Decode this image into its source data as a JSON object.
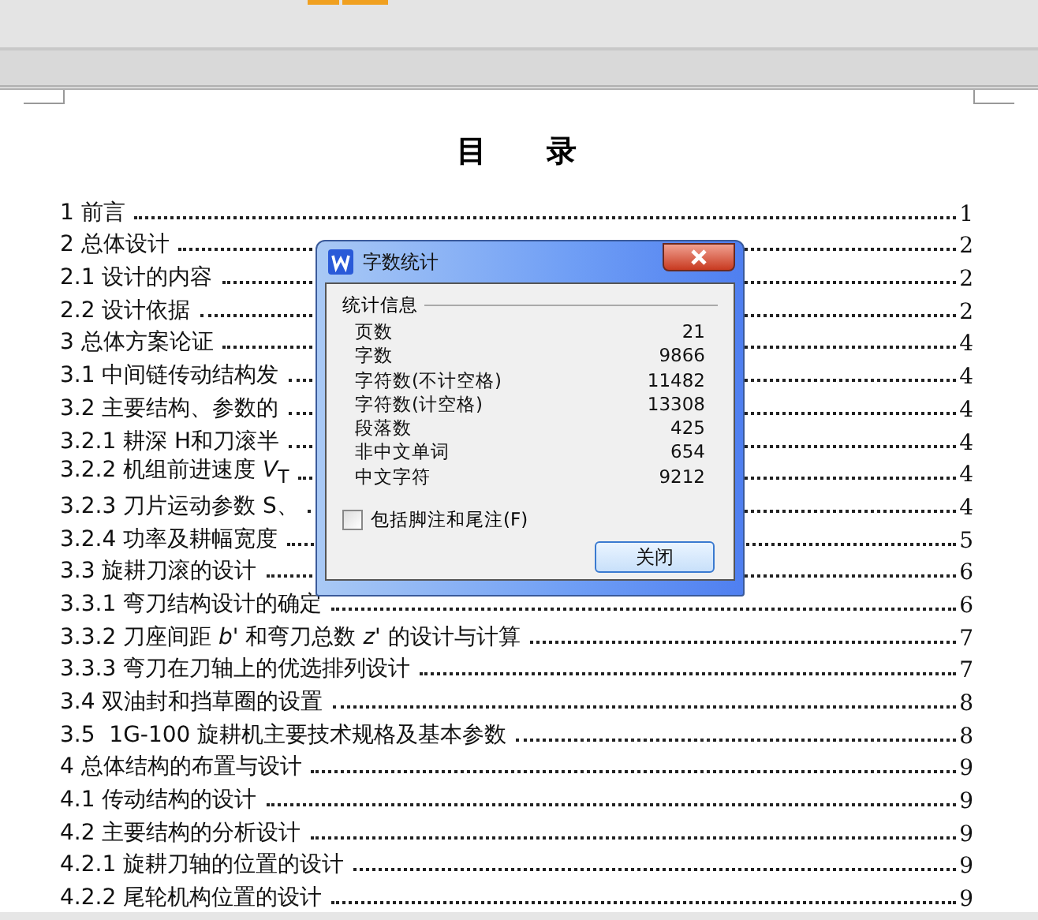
{
  "document": {
    "title": "目　　录",
    "toc": [
      {
        "text": "1 前言",
        "page": "1"
      },
      {
        "text": "2 总体设计",
        "page": "2"
      },
      {
        "text": "2.1 设计的内容",
        "page": "2"
      },
      {
        "text": "2.2 设计依据",
        "page": "2"
      },
      {
        "text": "3 总体方案论证",
        "page": "4"
      },
      {
        "text": "3.1 中间链传动结构发",
        "page": "4"
      },
      {
        "text": "3.2 主要结构、参数的",
        "page": "4"
      },
      {
        "text": "3.2.1 耕深 H和刀滚半",
        "page": "4"
      },
      {
        "text": "3.2.2 机组前进速度 *V*$_{T}$",
        "page": "4"
      },
      {
        "text": "3.2.3 刀片运动参数 S、",
        "page": "4"
      },
      {
        "text": "3.2.4 功率及耕幅宽度",
        "page": "5"
      },
      {
        "text": "3.3 旋耕刀滚的设计",
        "page": "6"
      },
      {
        "text": "3.3.1 弯刀结构设计的确定",
        "page": "6"
      },
      {
        "text": "3.3.2 刀座间距 *b'* 和弯刀总数 *z'* 的设计与计算",
        "page": "7"
      },
      {
        "text": "3.3.3 弯刀在刀轴上的优选排列设计",
        "page": "7"
      },
      {
        "text": "3.4 双油封和挡草圈的设置",
        "page": "8"
      },
      {
        "text": "3.5  1G-100 旋耕机主要技术规格及基本参数",
        "page": "8"
      },
      {
        "text": "4 总体结构的布置与设计",
        "page": "9"
      },
      {
        "text": "4.1 传动结构的设计",
        "page": "9"
      },
      {
        "text": "4.2 主要结构的分析设计",
        "page": "9"
      },
      {
        "text": "4.2.1 旋耕刀轴的位置的设计",
        "page": "9"
      },
      {
        "text": "4.2.2 尾轮机构位置的设计",
        "page": "9"
      }
    ]
  },
  "dialog": {
    "title": "字数统计",
    "group": "统计信息",
    "stats": [
      {
        "label": "页数",
        "value": "21"
      },
      {
        "label": "字数",
        "value": "9866"
      },
      {
        "label": "字符数(不计空格)",
        "value": "11482"
      },
      {
        "label": "字符数(计空格)",
        "value": "13308"
      },
      {
        "label": "段落数",
        "value": "425"
      },
      {
        "label": "非中文单词",
        "value": "654"
      },
      {
        "label": "中文字符",
        "value": "9212"
      }
    ],
    "checkbox": {
      "label": "包括脚注和尾注(F)",
      "checked": false
    },
    "button": "关闭"
  }
}
